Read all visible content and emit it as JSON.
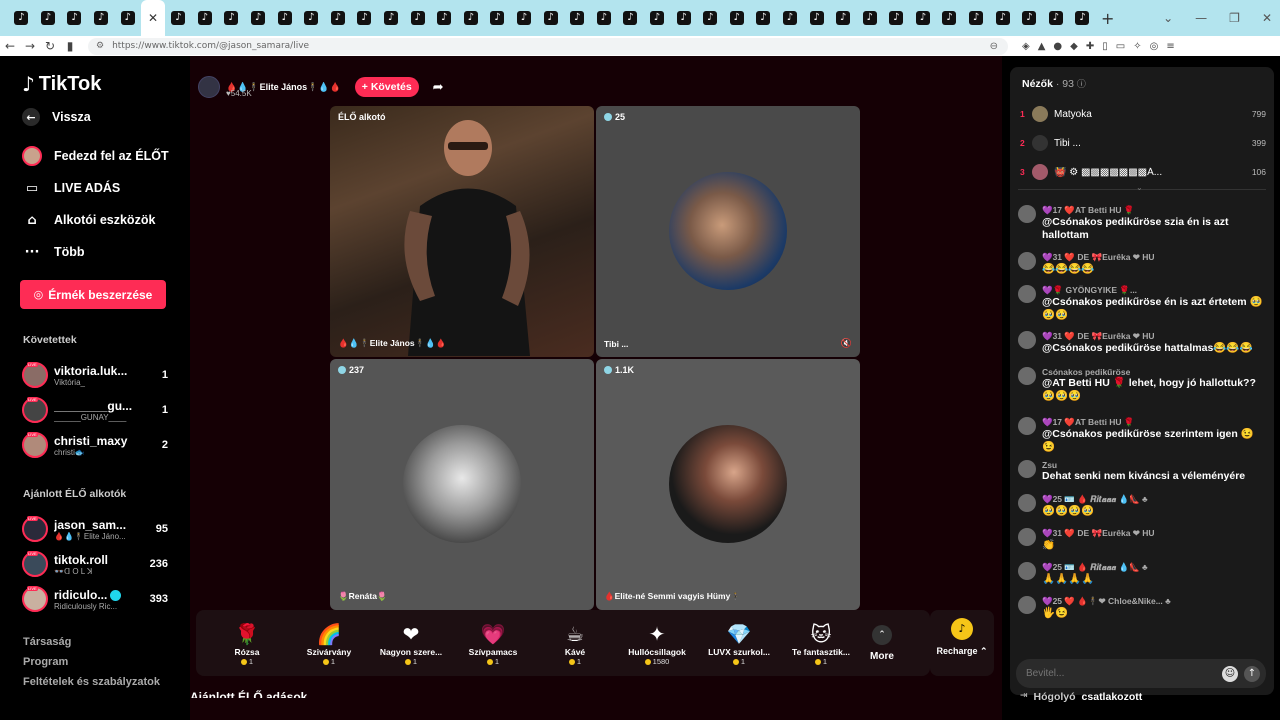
{
  "browser": {
    "tab_count": 41,
    "url": "https://www.tiktok.com/@jason_samara/live",
    "close_glyph": "✕",
    "new_tab_glyph": "+"
  },
  "sidebar": {
    "logo": "TikTok",
    "back": "Vissza",
    "nav": [
      {
        "label": "Fedezd fel az ÉLŐT",
        "icon": "live-avatar-icon"
      },
      {
        "label": "LIVE ADÁS",
        "icon": "video-camera-icon"
      },
      {
        "label": "Alkotói eszközök",
        "icon": "house-plus-icon"
      },
      {
        "label": "Több",
        "icon": "more-dots-icon"
      }
    ],
    "coins_button": "Érmék beszerzése",
    "following_heading": "Követettek",
    "following": [
      {
        "name": "viktoria.luk...",
        "sub": "Viktória_",
        "count": "1"
      },
      {
        "name": "________gu...",
        "sub": "______GUNAY____",
        "count": "1"
      },
      {
        "name": "christi_maxy",
        "sub": "christi🐟",
        "count": "2"
      }
    ],
    "recommended_heading": "Ajánlott ÉLŐ alkotók",
    "recommended": [
      {
        "name": "jason_sam...",
        "sub": "🩸💧🕴Elite Jáno...",
        "count": "95"
      },
      {
        "name": "tiktok.roll",
        "sub": "👓ꓷ O L ꓘ",
        "count": "236"
      },
      {
        "name": "ridiculo...",
        "sub": "Ridiculously Ric...",
        "count": "393",
        "verified": true
      }
    ],
    "footer": [
      "Társaság",
      "Program",
      "Feltételek és szabályzatok"
    ]
  },
  "live": {
    "host_name": "🩸💧🕴Elite János🕴💧🩸",
    "host_likes": "♥54.5K",
    "follow_button": "+ Követés",
    "host_tile_label": "ÉLŐ alkotó",
    "host_tile_name": "🩸💧🕴Elite János🕴💧🩸",
    "guests": [
      {
        "viewers": "25",
        "name": "Tibi ..."
      },
      {
        "viewers": "237",
        "name": "🌷Renáta🌷"
      },
      {
        "viewers": "1.1K",
        "name": "🩸Elite-né Semmi vagyis Hümy🕴"
      }
    ],
    "gifts": [
      {
        "name": "Rózsa",
        "price": "1",
        "icon": "🌹"
      },
      {
        "name": "Szivárvány",
        "price": "1",
        "icon": "🌈"
      },
      {
        "name": "Nagyon szere...",
        "price": "1",
        "icon": "❤"
      },
      {
        "name": "Szívpamacs",
        "price": "1",
        "icon": "💗"
      },
      {
        "name": "Kávé",
        "price": "1",
        "icon": "☕"
      },
      {
        "name": "Hullócsillagok",
        "price": "1580",
        "icon": "✦"
      },
      {
        "name": "LUVX szurkol...",
        "price": "1",
        "icon": "💎"
      },
      {
        "name": "Te fantasztik...",
        "price": "1",
        "icon": "🐱"
      }
    ],
    "more": "More",
    "recharge": "Recharge ⌃",
    "recommended_live": "Ajánlott ÉLŐ adások"
  },
  "chat": {
    "viewers_label": "Nézők",
    "viewers_count": "· 93",
    "top_viewers": [
      {
        "rank": "1",
        "name": "Matyoka",
        "points": "799"
      },
      {
        "rank": "2",
        "name": "Tibi ...",
        "points": "399"
      },
      {
        "rank": "3",
        "name": "👹 ⚙ ▩▩▩▩▩▩▩Á...",
        "points": "106"
      }
    ],
    "messages": [
      {
        "meta": "💜17 ❤️AT Betti HU 🌹",
        "text": "@Csónakos pedikűröse szia én is azt hallottam"
      },
      {
        "meta": "💜31 ❤️ DE 🎀Eurêka ❤ HU",
        "text": "😂😂😂😂"
      },
      {
        "meta": "💜🌹 GYÖNGYIKE 🌹...",
        "text": "@Csónakos pedikűröse én is azt értetem 🥹🥹🥹"
      },
      {
        "meta": "💜31 ❤️ DE 🎀Eurêka ❤ HU",
        "text": "@Csónakos pedikűröse hattalmas😂😂😂"
      },
      {
        "meta": "Csónakos pedikűröse",
        "text": "@AT Betti HU 🌹 lehet, hogy jó hallottuk?? 🥹🥹🥹"
      },
      {
        "meta": "💜17 ❤️AT Betti HU 🌹",
        "text": "@Csónakos pedikűröse szerintem igen 😉😉"
      },
      {
        "meta": "Zsu",
        "text": "Dehat senki nem kiváncsi a véleményére"
      },
      {
        "meta": "💜25 🪪 🩸 𝑹𝒊𝒕𝒂𝒂𝒂 💧👠 ♣",
        "text": "🥹🥹🥹🥹"
      },
      {
        "meta": "💜31 ❤️ DE 🎀Eurêka ❤ HU",
        "text": "👏"
      },
      {
        "meta": "💜25 🪪 🩸 𝑹𝒊𝒕𝒂𝒂𝒂 💧👠 ♣",
        "text": "🙏🙏🙏🙏"
      },
      {
        "meta": "💜25 ❤️ 🩸🕴❤ Chloe&Nike... ♣",
        "text": "🖐😉"
      }
    ],
    "join_name": "Hógolyó",
    "join_text": "csatlakozott",
    "input_placeholder": "Bevitel..."
  }
}
